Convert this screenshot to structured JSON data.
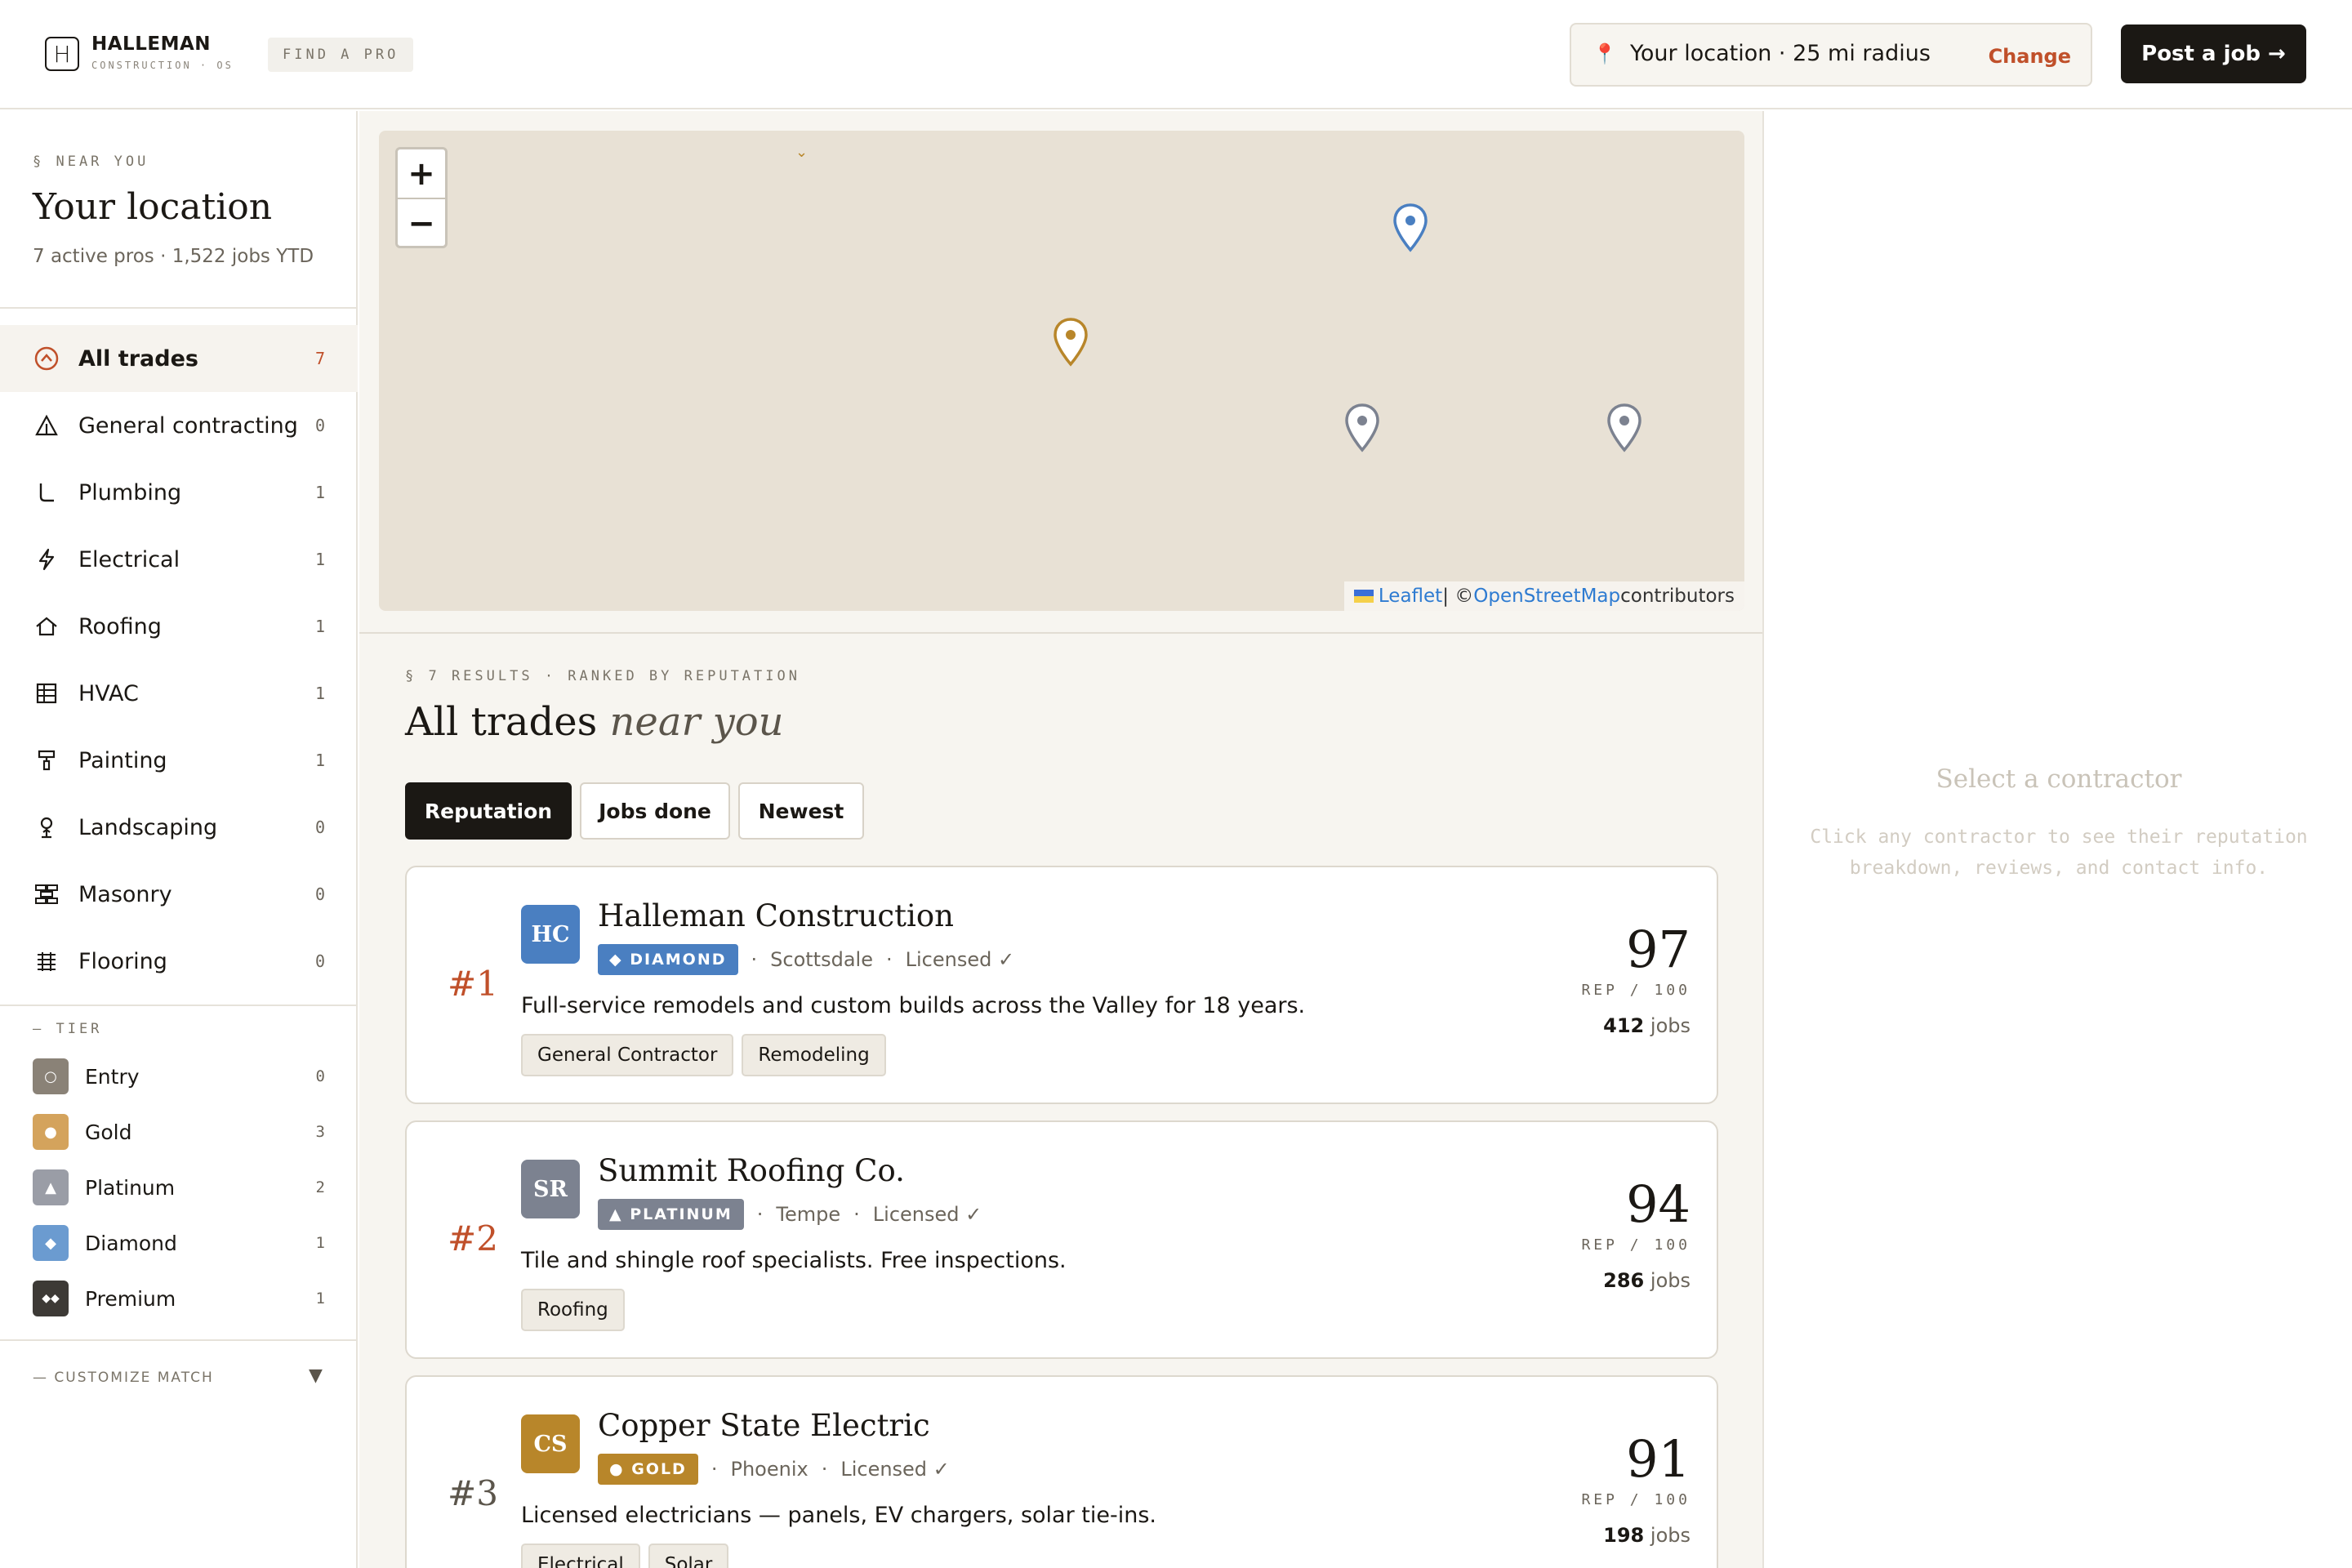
{
  "header": {
    "brand_name": "HALLEMAN",
    "brand_sub": "CONSTRUCTION · OS",
    "brand_mark": "H",
    "nav_find_pro": "FIND A PRO",
    "location_text": "Your location · 25 mi radius",
    "location_change": "Change",
    "post_job": "Post a job →"
  },
  "sidebar": {
    "section_label": "§ NEAR YOU",
    "title": "Your location",
    "subtitle": "7 active pros · 1,522 jobs YTD",
    "trades": [
      {
        "label": "All trades",
        "count": "7",
        "icon": "all-trades-icon"
      },
      {
        "label": "General contracting",
        "count": "0",
        "icon": "general-contracting-icon"
      },
      {
        "label": "Plumbing",
        "count": "1",
        "icon": "plumbing-icon"
      },
      {
        "label": "Electrical",
        "count": "1",
        "icon": "lightning-icon"
      },
      {
        "label": "Roofing",
        "count": "1",
        "icon": "roof-icon"
      },
      {
        "label": "HVAC",
        "count": "1",
        "icon": "hvac-icon"
      },
      {
        "label": "Painting",
        "count": "1",
        "icon": "paint-roller-icon"
      },
      {
        "label": "Landscaping",
        "count": "0",
        "icon": "landscaping-icon"
      },
      {
        "label": "Masonry",
        "count": "0",
        "icon": "masonry-icon"
      },
      {
        "label": "Flooring",
        "count": "0",
        "icon": "flooring-icon"
      }
    ],
    "tier_label": "— TIER",
    "tiers": [
      {
        "label": "Entry",
        "count": "0",
        "color": "#8a8277",
        "glyph": "○"
      },
      {
        "label": "Gold",
        "count": "3",
        "color": "#d4a35c",
        "glyph": "●"
      },
      {
        "label": "Platinum",
        "count": "2",
        "color": "#9a9da6",
        "glyph": "▲"
      },
      {
        "label": "Diamond",
        "count": "1",
        "color": "#6b9bd0",
        "glyph": "◆"
      },
      {
        "label": "Premium",
        "count": "1",
        "color": "#3d3a36",
        "glyph": "◆◆"
      }
    ],
    "customize_label": "— CUSTOMIZE MATCH"
  },
  "map": {
    "zoom_in": "+",
    "zoom_out": "−",
    "attribution_leaflet": "Leaflet",
    "attribution_sep": " | © ",
    "attribution_osm": "OpenStreetMap",
    "attribution_tail": " contributors"
  },
  "results": {
    "section_label": "§ 7 RESULTS · RANKED BY REPUTATION",
    "title_main": "All trades",
    "title_em": "near you",
    "sort_options": [
      "Reputation",
      "Jobs done",
      "Newest"
    ],
    "active_sort": "Reputation",
    "contractors": [
      {
        "rank": "#1",
        "initials": "HC",
        "avatar_color": "#4a7fc1",
        "name": "Halleman Construction",
        "tier": "◆ DIAMOND",
        "tier_color": "#4a7fc1",
        "city": "Scottsdale",
        "licensed": "Licensed ✓",
        "description": "Full-service remodels and custom builds across the Valley for 18 years.",
        "tags": [
          "General Contractor",
          "Remodeling"
        ],
        "score": "97",
        "rep_label": "REP / 100",
        "jobs_count": "412",
        "jobs_label": "jobs"
      },
      {
        "rank": "#2",
        "initials": "SR",
        "avatar_color": "#7c8290",
        "name": "Summit Roofing Co.",
        "tier": "▲ PLATINUM",
        "tier_color": "#7c8290",
        "city": "Tempe",
        "licensed": "Licensed ✓",
        "description": "Tile and shingle roof specialists. Free inspections.",
        "tags": [
          "Roofing"
        ],
        "score": "94",
        "rep_label": "REP / 100",
        "jobs_count": "286",
        "jobs_label": "jobs"
      },
      {
        "rank": "#3",
        "initials": "CS",
        "avatar_color": "#b8862a",
        "name": "Copper State Electric",
        "tier": "● GOLD",
        "tier_color": "#b8862a",
        "city": "Phoenix",
        "licensed": "Licensed ✓",
        "description": "Licensed electricians — panels, EV chargers, solar tie-ins.",
        "tags": [
          "Electrical",
          "Solar"
        ],
        "score": "91",
        "rep_label": "REP / 100",
        "jobs_count": "198",
        "jobs_label": "jobs"
      }
    ]
  },
  "detail": {
    "title": "Select a contractor",
    "description": "Click any contractor to see their reputation breakdown, reviews, and contact info."
  },
  "colors": {
    "accent": "#c0502a",
    "ink": "#1b1814",
    "map_bg": "#e8e1d5"
  }
}
